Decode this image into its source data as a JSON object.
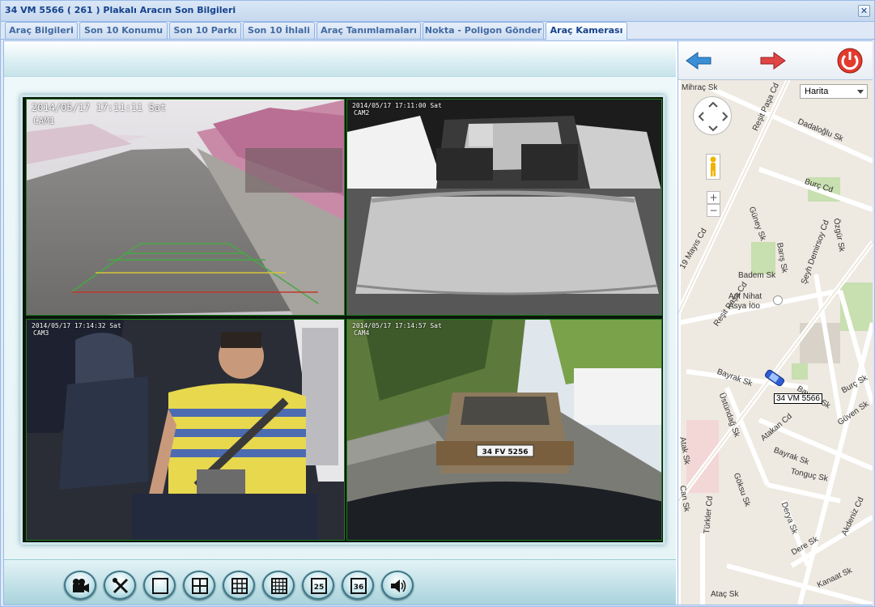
{
  "window": {
    "title": "34 VM 5566 ( 261 ) Plakalı Aracın Son Bilgileri",
    "close_glyph": "✕"
  },
  "tabs": [
    {
      "label": "Araç Bilgileri",
      "active": false
    },
    {
      "label": "Son 10 Konumu",
      "active": false
    },
    {
      "label": "Son 10 Parkı",
      "active": false
    },
    {
      "label": "Son 10 İhlali",
      "active": false
    },
    {
      "label": "Araç Tanımlamaları",
      "active": false
    },
    {
      "label": "Nokta - Poligon Gönder",
      "active": false
    },
    {
      "label": "Araç Kamerası",
      "active": true
    }
  ],
  "cameras": [
    {
      "timestamp": "2014/05/17  17:11:11 Sat",
      "label": "CAM1"
    },
    {
      "timestamp": "2014/05/17 17:11:00 Sat",
      "label": "CAM2"
    },
    {
      "timestamp": "2014/05/17 17:14:32 Sat",
      "label": "CAM3"
    },
    {
      "timestamp": "2014/05/17 17:14:57 Sat",
      "label": "CAM4"
    }
  ],
  "cam4_plate": "34 FV 5256",
  "toolbar": {
    "buttons": [
      {
        "name": "record-button",
        "icon": "camera-icon"
      },
      {
        "name": "settings-button",
        "icon": "tools-icon"
      },
      {
        "name": "layout-1-button",
        "icon": "grid-1-icon"
      },
      {
        "name": "layout-4-button",
        "icon": "grid-4-icon"
      },
      {
        "name": "layout-9-button",
        "icon": "grid-9-icon"
      },
      {
        "name": "layout-16-button",
        "icon": "grid-16-icon"
      },
      {
        "name": "layout-25-button",
        "icon": "grid-25-icon",
        "label": "25"
      },
      {
        "name": "layout-36-button",
        "icon": "grid-36-icon",
        "label": "36"
      },
      {
        "name": "sound-button",
        "icon": "speaker-icon"
      }
    ]
  },
  "map": {
    "type_select": "Harita",
    "vehicle_label": "34 VM 5566",
    "streets": [
      "Mihraç Sk",
      "Reşit Paşa Cd",
      "Dadaloğlu Sk",
      "Burç Cd",
      "Güney Sk",
      "Özgür Sk",
      "Barış Sk",
      "Şeyh Demirsoy Cd",
      "Badem Sk",
      "Reşit Paşa Cd",
      "19 Mayıs Cd",
      "Bayrak Sk",
      "Üstündağ Sk",
      "Atakan Cd",
      "Bayrak Sk",
      "Güven Sk",
      "Tonguç Sk",
      "Bayrak Sk",
      "Göksu Sk",
      "Derya Sk",
      "Can Sk",
      "Türkler Cd",
      "Akdeniz Cd",
      "Dere Sk",
      "Ataç Sk",
      "Kanaat Sk",
      "Burç Sk",
      "Atak Sk"
    ],
    "poi": "Arif Nihat Asya İöo",
    "zoom_in": "+",
    "zoom_out": "−"
  },
  "colors": {
    "tab_text": "#416aa3",
    "title_text": "#15428b",
    "accent": "#99bbe8"
  }
}
